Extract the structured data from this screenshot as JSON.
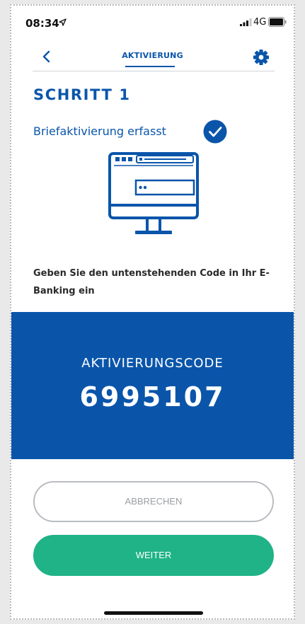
{
  "statusbar": {
    "time": "08:34",
    "network": "4G",
    "location_icon": "location-arrow-icon",
    "signal_icon": "signal-bars-icon",
    "battery_icon": "battery-icon"
  },
  "navbar": {
    "title": "AKTIVIERUNG",
    "back_icon": "chevron-left-icon",
    "settings_icon": "gear-icon"
  },
  "step": {
    "title": "SCHRITT 1",
    "status": "Briefaktivierung erfasst",
    "status_icon": "checkmark-circle-icon",
    "illustration_icon": "monitor-icon"
  },
  "instruction": "Geben Sie den untenstehenden Code in Ihr E-Banking ein",
  "code_panel": {
    "label": "AKTIVIERUNGSCODE",
    "code": "6995107"
  },
  "buttons": {
    "cancel_label": "ABBRECHEN",
    "next_label": "WEITER"
  },
  "colors": {
    "brand_blue": "#0a55aa",
    "accent_green": "#1fb387",
    "background": "#ffffff"
  }
}
